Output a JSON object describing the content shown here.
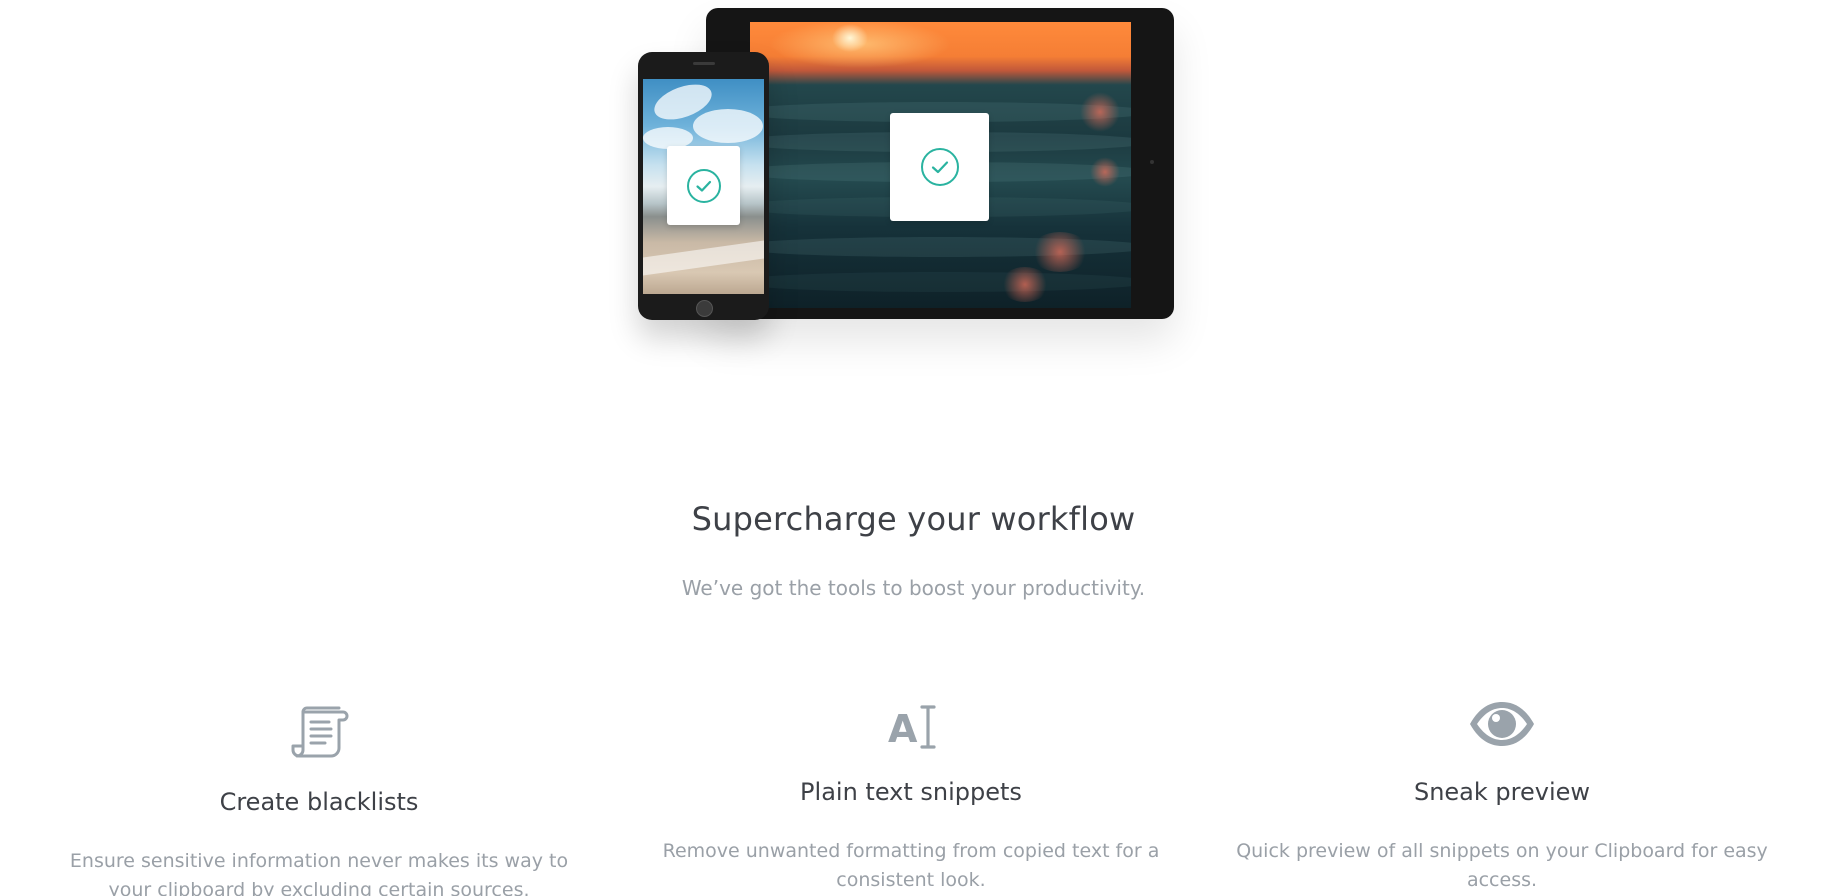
{
  "section": {
    "title": "Supercharge your workflow",
    "subtitle": "We’ve got the tools to boost your productivity."
  },
  "features": [
    {
      "icon": "document-scroll-icon",
      "title": "Create blacklists",
      "description": "Ensure sensitive information never makes its way to your clipboard by excluding certain sources."
    },
    {
      "icon": "text-cursor-icon",
      "title": "Plain text snippets",
      "description": "Remove unwanted formatting from copied text for a consistent look."
    },
    {
      "icon": "eye-icon",
      "title": "Sneak preview",
      "description": "Quick preview of all snippets on your Clipboard for easy access."
    }
  ],
  "colors": {
    "heading": "#3e4147",
    "body": "#9aa0a7",
    "icon": "#9aa3ab",
    "check_accent": "#2ab3a0"
  },
  "hero": {
    "image": "tablet-and-phone-mockup",
    "check_icons": [
      "check-circle-icon",
      "check-circle-icon"
    ]
  }
}
